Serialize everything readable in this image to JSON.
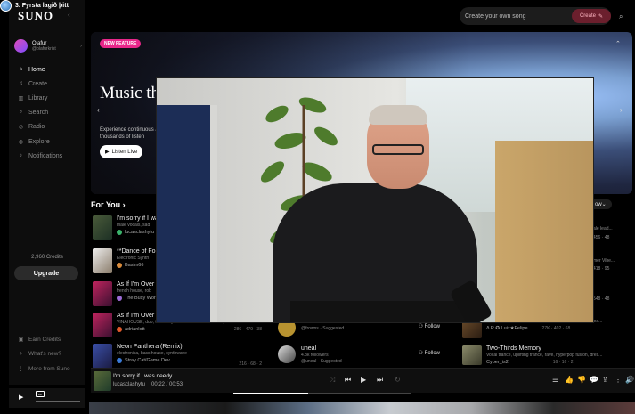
{
  "meeting": {
    "title": "3. Fyrsta lagið þitt"
  },
  "app": {
    "logo": "SUNO"
  },
  "user": {
    "name": "Olafur",
    "handle": "@olafurkrist"
  },
  "nav": [
    {
      "label": "Home",
      "icon": "home-icon"
    },
    {
      "label": "Create",
      "icon": "create-icon"
    },
    {
      "label": "Library",
      "icon": "library-icon"
    },
    {
      "label": "Search",
      "icon": "search-icon"
    },
    {
      "label": "Radio",
      "icon": "radio-icon"
    },
    {
      "label": "Explore",
      "icon": "explore-icon"
    },
    {
      "label": "Notifications",
      "icon": "bell-icon"
    }
  ],
  "credits": "2,960 Credits",
  "upgrade_label": "Upgrade",
  "bottom_nav": [
    {
      "label": "Earn Credits"
    },
    {
      "label": "What's new?"
    },
    {
      "label": "More from Suno"
    }
  ],
  "header": {
    "search_placeholder": "Create your own song",
    "create_label": "Create"
  },
  "hero": {
    "badge": "NEW FEATURE",
    "title": "Music tha built live",
    "desc": "Experience continuous Join thousands of listen",
    "listen_label": "Listen Live"
  },
  "for_you": {
    "title": "For You",
    "filter": "ow"
  },
  "songs": [
    {
      "title": "I'm sorry if I wa",
      "genre": "male vocals, sad",
      "artist": "lucasclashytu",
      "colors": [
        "#4a5b3a",
        "#1c2f24"
      ]
    },
    {
      "title": "**Dance of For",
      "genre": "Electronic Synth",
      "artist": "Basim66",
      "colors": [
        "#eeeeee",
        "#8a7c6a"
      ]
    },
    {
      "title": "As If I'm Over Y",
      "genre": "french house, rob",
      "artist": "The Busy Wor",
      "colors": [
        "#c0245e",
        "#3a1030"
      ]
    },
    {
      "title": "As If I'm Over Y",
      "genre": "VINAHOUSE, duo, 80 heavy bass and drum surround, Me...",
      "artist": "adrianlott",
      "colors": [
        "#c0245e",
        "#3a1030"
      ],
      "stats": "286 · 479 · 38"
    },
    {
      "title": "Neon Panthera (Remix)",
      "genre": "electronica, bass house, synthwave",
      "artist": "Stray Cat/Game Dev",
      "colors": [
        "#3a4fa8",
        "#1a1a40"
      ],
      "stats": "216 · 68 · 2"
    }
  ],
  "right_col": [
    {
      "text": "ale lead..."
    },
    {
      "text": "456 · 48"
    },
    {
      "text": "mer Vibe..."
    },
    {
      "text": "418 · 95"
    },
    {
      "text": "548 · 48"
    }
  ],
  "artists": [
    {
      "name": "",
      "followers": "5.6k followers",
      "suggest": "@frowns · Suggested",
      "follow_label": "Follow"
    },
    {
      "name": "uneal",
      "followers": "4.8k followers",
      "suggest": "@uneal · Suggested",
      "follow_label": "Follow"
    }
  ],
  "right_songs": [
    {
      "title": "",
      "genre": "lofi-punk, cinematic rock, acoustic singer-songwriter, Hea...",
      "artist": "Δ R ✪ Luiz★Felipe",
      "stats": "27K · 402 · 68"
    },
    {
      "title": "Two-Thirds Memory",
      "genre": "Vocal trance, uplifting trance, rave, hyperpop fusion, dres...",
      "artist": "Cyber_is2",
      "stats": "16 · 16 · 2"
    }
  ],
  "player": {
    "title": "I'm sorry if I was needy.",
    "artist": "lucasclashytu",
    "time": "00:22 / 00:53",
    "progress": 0.42
  },
  "colors": {
    "accent": "#e8278a",
    "create_bg": "#6b1f2d"
  }
}
